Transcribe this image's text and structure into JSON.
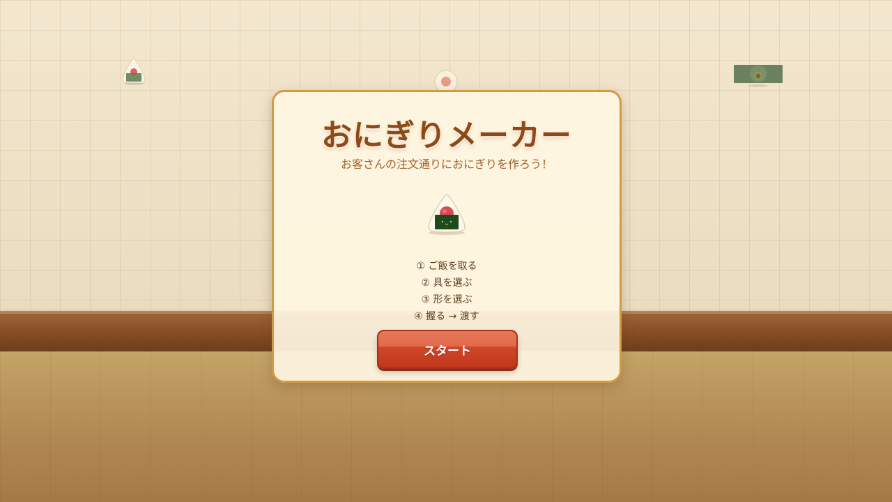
{
  "game": {
    "title": "おにぎりメーカー",
    "subtitle": "お客さんの注文通りにおにぎりを作ろう！",
    "steps": [
      "① ご飯を取る",
      "② 具を選ぶ",
      "③ 形を選ぶ",
      "④ 握る → 渡す"
    ],
    "start_label": "スタート"
  },
  "icons": {
    "hero": "onigiri-icon",
    "deco_1": "onigiri-icon",
    "deco_2": "ume-plate-icon",
    "deco_3": "nori-sheet-icon"
  },
  "colors": {
    "title": "#8c4a18",
    "panel_border": "#d39a45",
    "button": "#c2371c",
    "nori": "#1f4a1c",
    "umeboshi": "#d9485a",
    "rice": "#fbf7ea"
  }
}
